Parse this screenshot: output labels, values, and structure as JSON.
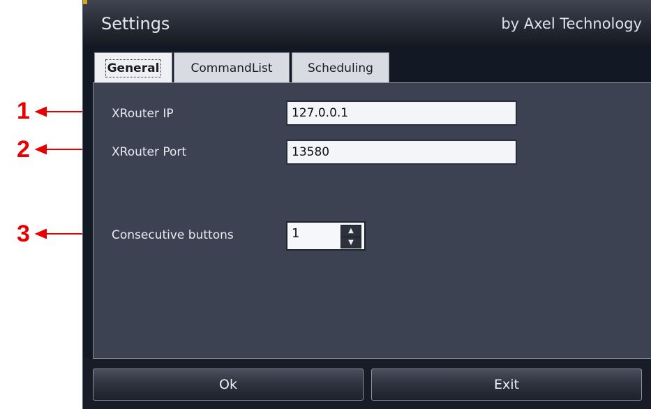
{
  "window": {
    "title": "Settings",
    "brand": "by Axel Technology"
  },
  "tabs": [
    {
      "label": "General",
      "active": true
    },
    {
      "label": "CommandList",
      "active": false
    },
    {
      "label": "Scheduling",
      "active": false
    }
  ],
  "general": {
    "xrouter_ip_label": "XRouter IP",
    "xrouter_ip_value": "127.0.0.1",
    "xrouter_port_label": "XRouter Port",
    "xrouter_port_value": "13580",
    "consecutive_label": "Consecutive buttons",
    "consecutive_value": "1"
  },
  "buttons": {
    "ok": "Ok",
    "exit": "Exit"
  },
  "annotations": [
    {
      "number": "1",
      "target": "XRouter IP"
    },
    {
      "number": "2",
      "target": "XRouter Port"
    },
    {
      "number": "3",
      "target": "Consecutive buttons"
    }
  ],
  "colors": {
    "annotation": "#e60000",
    "panel": "#3d4253",
    "titlebar": "#272b36"
  }
}
